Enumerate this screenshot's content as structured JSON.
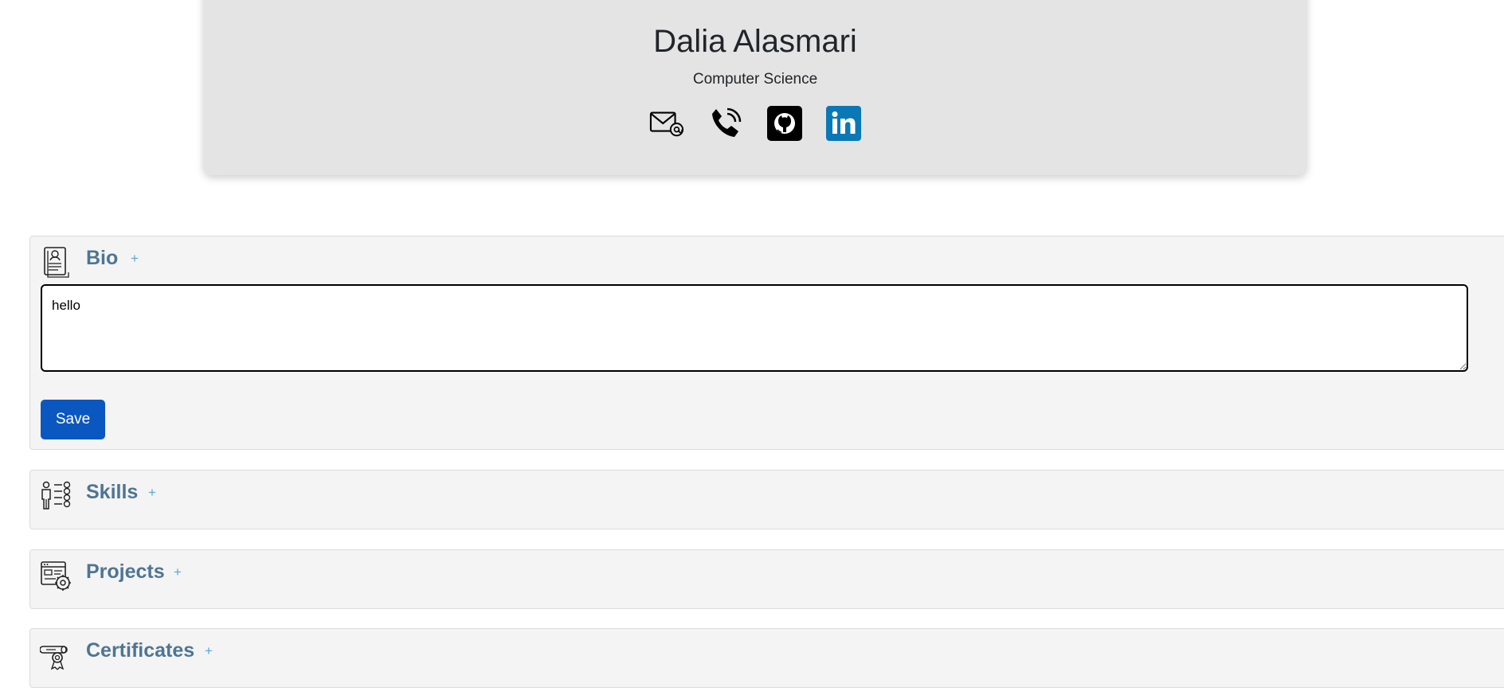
{
  "profile": {
    "name": "Dalia Alasmari",
    "major": "Computer Science",
    "contacts": [
      {
        "icon": "email-icon"
      },
      {
        "icon": "phone-icon"
      },
      {
        "icon": "github-icon"
      },
      {
        "icon": "linkedin-icon"
      }
    ]
  },
  "sections": {
    "bio": {
      "title": "Bio",
      "plus": "+",
      "icon": "resume-document-icon",
      "textarea_value": "hello",
      "save_label": "Save"
    },
    "skills": {
      "title": "Skills",
      "plus": "+",
      "icon": "person-checklist-icon"
    },
    "projects": {
      "title": "Projects",
      "plus": "+",
      "icon": "web-settings-icon"
    },
    "certificates": {
      "title": "Certificates",
      "plus": "+",
      "icon": "diploma-award-icon"
    }
  },
  "colors": {
    "section_title": "#4e7594",
    "plus": "#5aa6d8",
    "save_button": "#0b57c0",
    "linkedin": "#0a78b5",
    "card_bg": "#e4e4e4"
  }
}
